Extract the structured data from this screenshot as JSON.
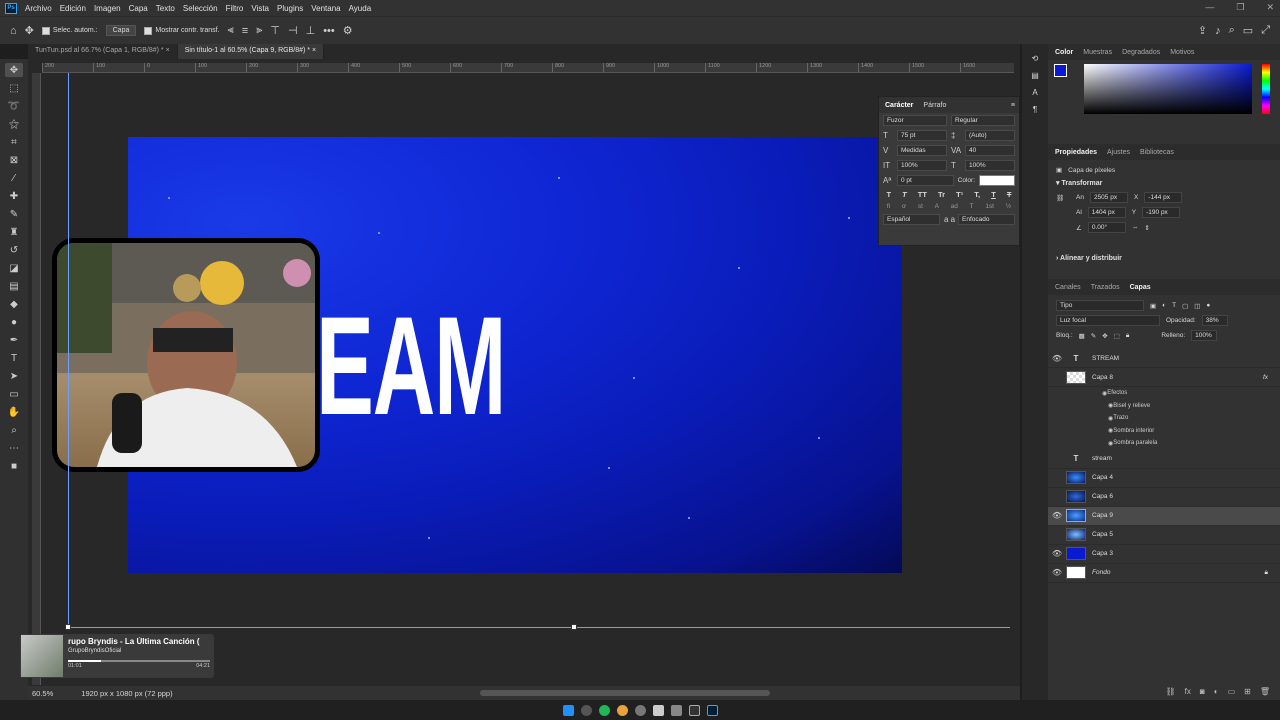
{
  "menubar": {
    "app_badge": "Ps",
    "items": [
      "Archivo",
      "Edición",
      "Imagen",
      "Capa",
      "Texto",
      "Selección",
      "Filtro",
      "Vista",
      "Plugins",
      "Ventana",
      "Ayuda"
    ]
  },
  "options": {
    "auto_select": "Selec. autom.:",
    "layer_select": "Capa",
    "show_transform": "Mostrar contr. transf."
  },
  "tabs": [
    {
      "label": "TunTun.psd al 66.7% (Capa 1, RGB/8#) *"
    },
    {
      "label": "Sin título-1 al 60.5% (Capa 9, RGB/8#) *"
    }
  ],
  "ruler": [
    "200",
    "100",
    "0",
    "100",
    "200",
    "300",
    "400",
    "500",
    "600",
    "700",
    "800",
    "900",
    "1000",
    "1100",
    "1200",
    "1300",
    "1400",
    "1500",
    "1600",
    "1700"
  ],
  "canvas": {
    "visible_text": "EAM"
  },
  "character": {
    "tabs": [
      "Carácter",
      "Párrafo"
    ],
    "font_family": "Fuzor",
    "font_style": "Regular",
    "size": "75 pt",
    "leading": "(Auto)",
    "kerning": "Medidas",
    "tracking": "40",
    "vscale": "100%",
    "hscale": "100%",
    "baseline": "0 pt",
    "color_label": "Color:",
    "glyphs_row1": [
      "T",
      "T",
      "TT",
      "Tr",
      "T¹",
      "T,",
      "T",
      "T"
    ],
    "glyphs_row2": [
      "fi",
      "ơ",
      "st",
      "A",
      "ad",
      "T",
      "1st",
      "½"
    ],
    "language": "Español",
    "aa_label": "a a",
    "antialias": "Enfocado"
  },
  "status": {
    "zoom": "60.5%",
    "doc_info": "1920 px x 1080 px (72 ppp)"
  },
  "media": {
    "title": "rupo Bryndis - La Última Canción (",
    "channel": "GrupoBryndisOficial",
    "time_current": "01:01",
    "time_total": "04:21",
    "progress": 0.23
  },
  "color_panel": {
    "tabs": [
      "Color",
      "Muestras",
      "Degradados",
      "Motivos"
    ],
    "fg_color": "#0a1ad0"
  },
  "properties": {
    "tabs": [
      "Propiedades",
      "Ajustes",
      "Bibliotecas"
    ],
    "kind": "Capa de píxeles",
    "transform_title": "Transformar",
    "w_label": "An",
    "w": "2505 px",
    "x_label": "X",
    "x": "-144 px",
    "h_label": "Al",
    "h": "1404 px",
    "y_label": "Y",
    "y": "-190 px",
    "angle": "0.00°",
    "align_title": "Alinear y distribuir"
  },
  "layers_panel": {
    "tabs": [
      "Canales",
      "Trazados",
      "Capas"
    ],
    "filter": "Tipo",
    "blend": "Luz focal",
    "opacity_label": "Opacidad:",
    "opacity": "38%",
    "lock_label": "Bloq.:",
    "fill_label": "Relleno:",
    "fill": "100%",
    "layers": [
      {
        "name": "STREAM",
        "type": "text",
        "visible": true,
        "selected": false
      },
      {
        "name": "Capa 8",
        "type": "checker",
        "visible": false,
        "selected": false,
        "has_fx": true
      },
      {
        "name": "stream",
        "type": "text",
        "visible": false,
        "selected": false
      },
      {
        "name": "Capa 4",
        "type": "space",
        "visible": false,
        "selected": false
      },
      {
        "name": "Capa 6",
        "type": "space",
        "visible": false,
        "selected": false
      },
      {
        "name": "Capa 9",
        "type": "space",
        "visible": true,
        "selected": true
      },
      {
        "name": "Capa 5",
        "type": "space",
        "visible": false,
        "selected": false
      },
      {
        "name": "Capa 3",
        "type": "blue",
        "visible": true,
        "selected": false
      },
      {
        "name": "Fondo",
        "type": "white",
        "visible": true,
        "selected": false
      }
    ],
    "effects_title": "Efectos",
    "effects": [
      "Bisel y relieve",
      "Trazo",
      "Sombra interior",
      "Sombra paralela"
    ],
    "fx_badge": "fx"
  }
}
